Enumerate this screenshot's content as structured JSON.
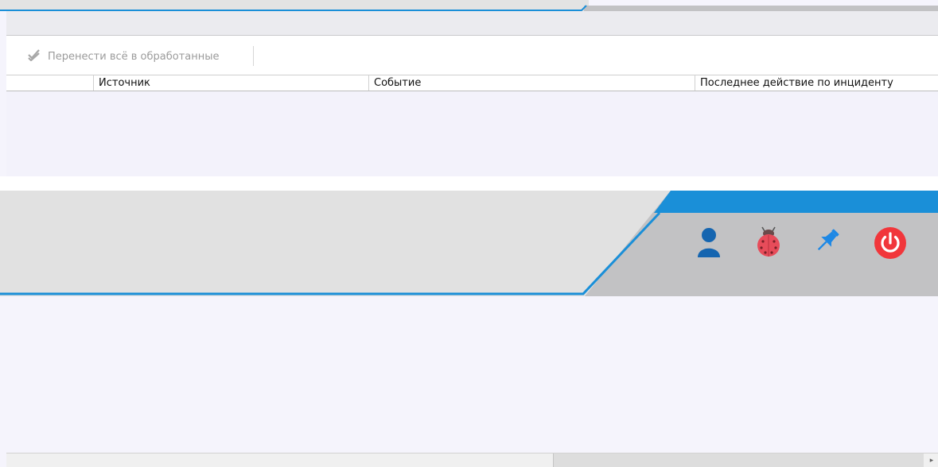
{
  "toolbar": {
    "move_all_label": "Перенести всё в обработанные",
    "move_all_icon": "double-check-icon"
  },
  "table": {
    "columns": [
      "",
      "Источник",
      "Событие",
      "Последнее действие по инциденту"
    ],
    "rows": []
  },
  "header_icons": [
    {
      "name": "user-icon",
      "color": "#1565b0"
    },
    {
      "name": "ladybug-icon",
      "color": "#e74c5a"
    },
    {
      "name": "pin-icon",
      "color": "#1e88e5"
    },
    {
      "name": "power-icon",
      "color": "#f1363b"
    }
  ],
  "colors": {
    "accent_blue": "#1a8fd8",
    "header_light": "#e1e1e1",
    "header_dark": "#c2c2c4",
    "content_bg": "#f5f4fc"
  },
  "scrollbar": {
    "right_arrow": "▸"
  }
}
